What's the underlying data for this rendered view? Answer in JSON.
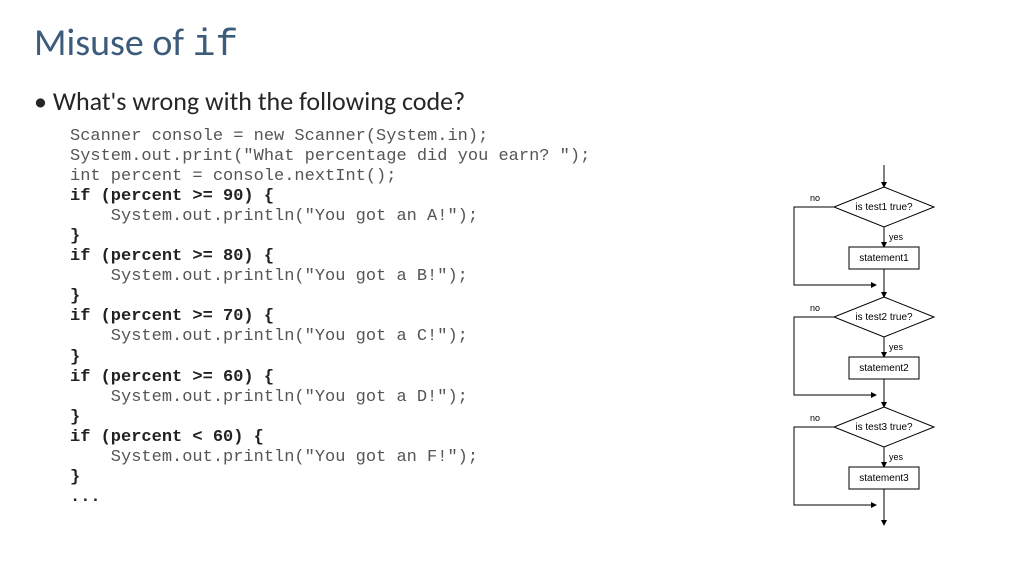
{
  "title": {
    "prefix": "Misuse of ",
    "mono": "if"
  },
  "bullet": "What's wrong with the following code?",
  "code": {
    "l01": "Scanner console = new Scanner(System.in);",
    "l02": "System.out.print(\"What percentage did you earn? \");",
    "l03": "int percent = console.nextInt();",
    "l04": "if (percent >= 90) {",
    "l05": "    System.out.println(\"You got an A!\");",
    "l06": "}",
    "l07": "if (percent >= 80) {",
    "l08": "    System.out.println(\"You got a B!\");",
    "l09": "}",
    "l10": "if (percent >= 70) {",
    "l11": "    System.out.println(\"You got a C!\");",
    "l12": "}",
    "l13": "if (percent >= 60) {",
    "l14": "    System.out.println(\"You got a D!\");",
    "l15": "}",
    "l16": "if (percent < 60) {",
    "l17": "    System.out.println(\"You got an F!\");",
    "l18": "}",
    "l19": "..."
  },
  "flow": {
    "no": "no",
    "yes": "yes",
    "test1": "is test1 true?",
    "stmt1": "statement1",
    "test2": "is test2 true?",
    "stmt2": "statement2",
    "test3": "is test3 true?",
    "stmt3": "statement3"
  }
}
